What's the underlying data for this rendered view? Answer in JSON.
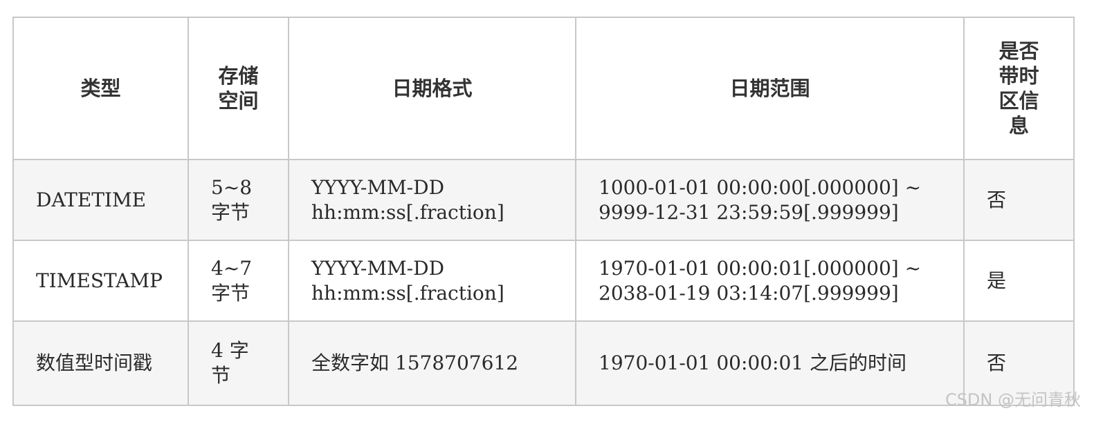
{
  "table": {
    "headers": [
      "类型",
      "存储空间",
      "日期格式",
      "日期范围",
      "是否带时区信息"
    ],
    "rows": [
      [
        "DATETIME",
        "5~8 字节",
        "YYYY-MM-DD hh:mm:ss[.fraction]",
        "1000-01-01 00:00:00[.000000] ~ 9999-12-31 23:59:59[.999999]",
        "否"
      ],
      [
        "TIMESTAMP",
        "4~7 字节",
        "YYYY-MM-DD hh:mm:ss[.fraction]",
        "1970-01-01 00:00:01[.000000] ~ 2038-01-19 03:14:07[.999999]",
        "是"
      ],
      [
        "数值型时间戳",
        "4 字节",
        "全数字如 1578707612",
        "1970-01-01 00:00:01 之后的时间",
        "否"
      ]
    ]
  },
  "watermark": "CSDN @无问青秋"
}
